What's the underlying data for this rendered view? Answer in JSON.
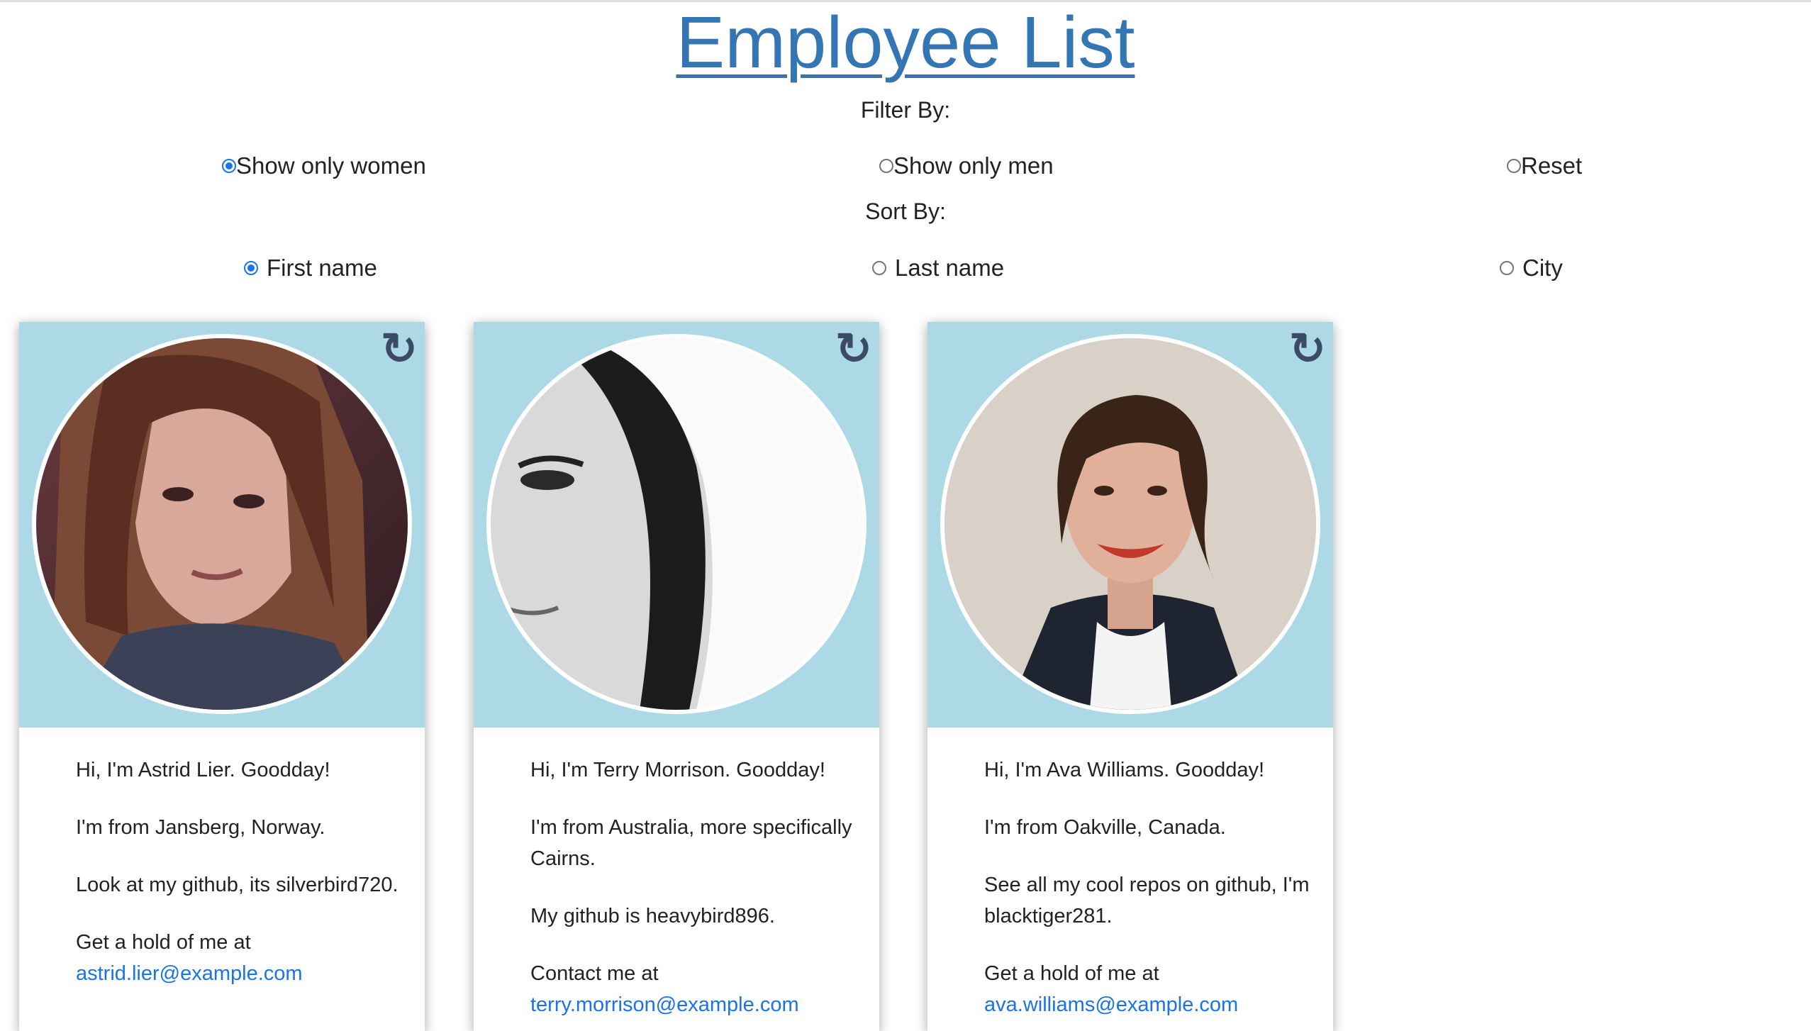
{
  "title": "Employee List",
  "filter": {
    "label": "Filter By:",
    "options": [
      {
        "label": "Show only women",
        "checked": true
      },
      {
        "label": "Show only men",
        "checked": false
      },
      {
        "label": "Reset",
        "checked": false
      }
    ]
  },
  "sort": {
    "label": "Sort By:",
    "options": [
      {
        "label": "First name",
        "checked": true
      },
      {
        "label": "Last name",
        "checked": false
      },
      {
        "label": "City",
        "checked": false
      }
    ]
  },
  "refresh_icon": "↻",
  "cards": [
    {
      "greeting": "Hi, I'm Astrid Lier. Goodday!",
      "origin": "I'm from Jansberg, Norway.",
      "github": "Look at my github, its silverbird720.",
      "contact": "Get a hold of me at",
      "email": "astrid.lier@example.com",
      "avatar_icon": "portrait-photo"
    },
    {
      "greeting": "Hi, I'm Terry Morrison. Goodday!",
      "origin": "I'm from Australia, more specifically Cairns.",
      "github": "My github is heavybird896.",
      "contact": "Contact me at",
      "email": "terry.morrison@example.com",
      "avatar_icon": "portrait-photo"
    },
    {
      "greeting": "Hi, I'm Ava Williams. Goodday!",
      "origin": "I'm from Oakville, Canada.",
      "github": "See all my cool repos on github, I'm blacktiger281.",
      "contact": "Get a hold of me at",
      "email": "ava.williams@example.com",
      "avatar_icon": "portrait-photo"
    }
  ],
  "colors": {
    "title_link": "#3476b4",
    "card_header": "#add8e6",
    "email_link": "#1a73e8",
    "radio_checked": "#1a73e8"
  }
}
